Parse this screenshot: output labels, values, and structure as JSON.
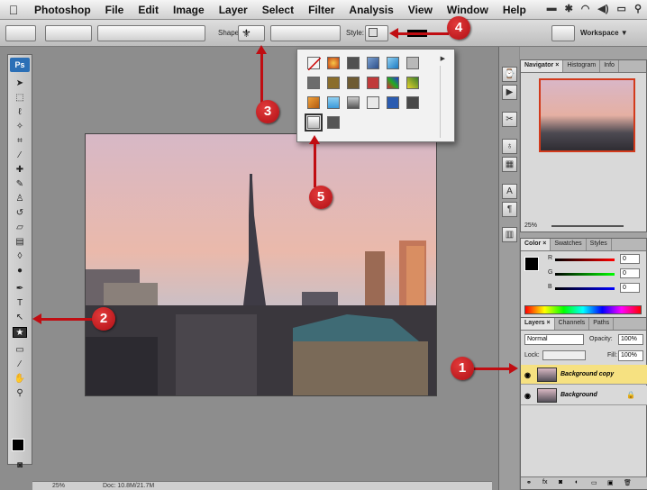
{
  "menubar": {
    "apple_icon": "apple-icon",
    "items": [
      "Photoshop",
      "File",
      "Edit",
      "Image",
      "Layer",
      "Select",
      "Filter",
      "Analysis",
      "View",
      "Window",
      "Help"
    ]
  },
  "options_bar": {
    "shape_label": "Shape:",
    "style_label": "Style:",
    "workspace_label": "Workspace ▼"
  },
  "toolbox": {
    "logo": "Ps"
  },
  "styles_popup": {
    "selected_index": 18
  },
  "status_bar": {
    "zoom": "25%",
    "doc": "Doc: 10.8M/21.7M"
  },
  "navigator": {
    "tabs": [
      "Navigator ×",
      "Histogram",
      "Info"
    ],
    "zoom": "25%"
  },
  "color_panel": {
    "tabs": [
      "Color ×",
      "Swatches",
      "Styles"
    ],
    "r_label": "R",
    "g_label": "G",
    "b_label": "B",
    "r_value": "0",
    "g_value": "0",
    "b_value": "0"
  },
  "layers_panel": {
    "tabs": [
      "Layers ×",
      "Channels",
      "Paths"
    ],
    "blend_mode": "Normal",
    "opacity_label": "Opacity:",
    "opacity_value": "100%",
    "lock_label": "Lock:",
    "fill_label": "Fill:",
    "fill_value": "100%",
    "layers": [
      {
        "name": "Background copy"
      },
      {
        "name": "Background"
      }
    ]
  },
  "callouts": [
    "1",
    "2",
    "3",
    "4",
    "5"
  ],
  "accent": "#c00d12"
}
